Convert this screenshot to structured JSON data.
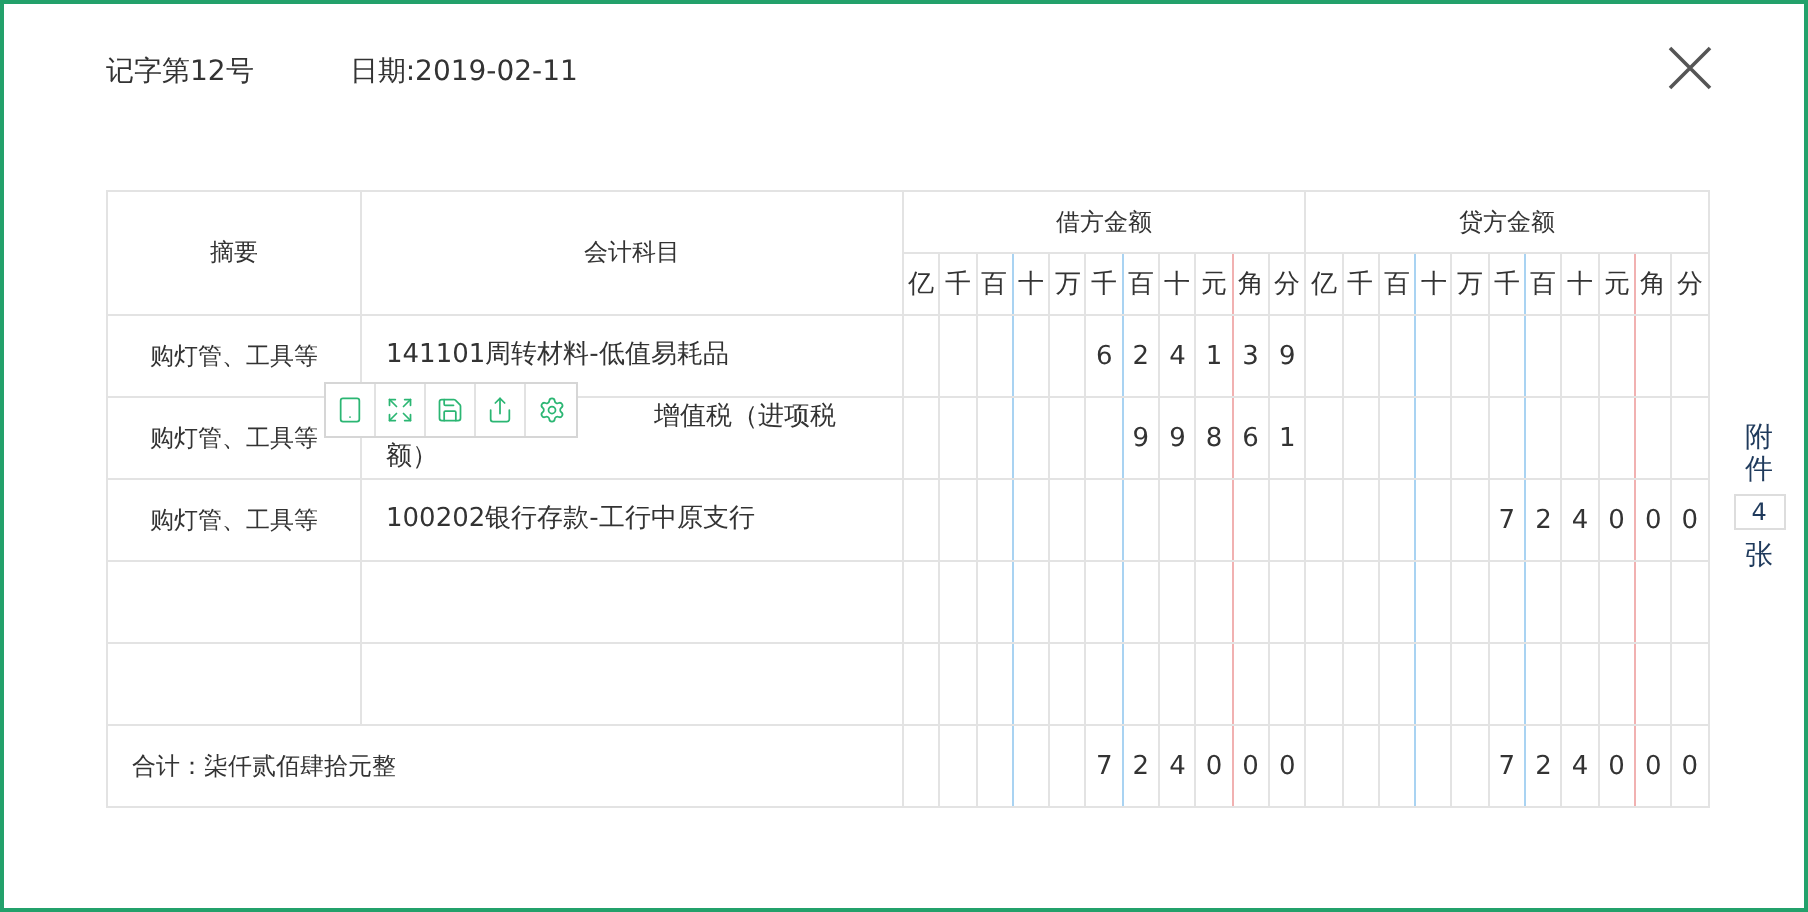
{
  "header": {
    "voucher_no": "记字第12号",
    "date": "日期:2019-02-11"
  },
  "table": {
    "columns": {
      "summary": "摘要",
      "account": "会计科目",
      "debit": "借方金额",
      "credit": "贷方金额"
    },
    "debit_units": [
      "亿",
      "千",
      "百",
      "十",
      "万",
      "千",
      "百",
      "十",
      "元",
      "角",
      "分"
    ],
    "credit_units": [
      "亿",
      "千",
      "百",
      "十",
      "万",
      "千",
      "百",
      "十",
      "元",
      "角",
      "分"
    ],
    "rows": [
      {
        "summary": "购灯管、工具等",
        "account": "141101周转材料-低值易耗品",
        "account_partly_covered": false,
        "debit": [
          "6",
          "2",
          "4",
          "1",
          "3",
          "9"
        ],
        "credit": []
      },
      {
        "summary": "购灯管、工具等",
        "account_lines": [
          "增值税（进项税",
          "额）"
        ],
        "account_partly_covered": true,
        "debit": [
          "9",
          "9",
          "8",
          "6",
          "1"
        ],
        "credit": []
      },
      {
        "summary": "购灯管、工具等",
        "account": "100202银行存款-工行中原支行",
        "account_partly_covered": false,
        "debit": [],
        "credit": [
          "7",
          "2",
          "4",
          "0",
          "0",
          "0"
        ]
      },
      {
        "debit": [],
        "credit": []
      },
      {
        "debit": [],
        "credit": []
      }
    ],
    "total": {
      "label": "合计：柒仟贰佰肆拾元整",
      "debit": [
        "7",
        "2",
        "4",
        "0",
        "0",
        "0"
      ],
      "credit": [
        "7",
        "2",
        "4",
        "0",
        "0",
        "0"
      ]
    }
  },
  "attachment": {
    "label_top": "附件",
    "count": "4",
    "label_bottom": "张"
  }
}
